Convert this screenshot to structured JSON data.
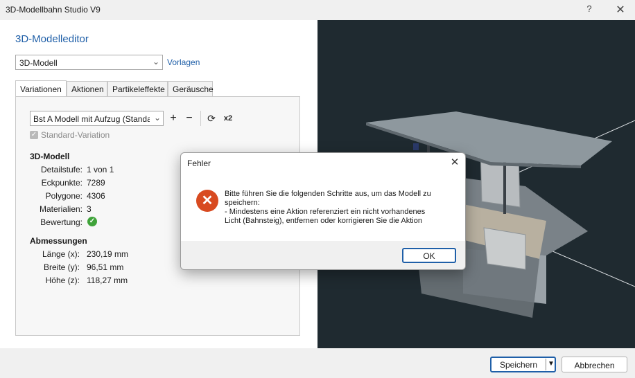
{
  "window": {
    "title": "3D-Modellbahn Studio V9",
    "help": "?",
    "close": "✕"
  },
  "editor": {
    "heading": "3D-Modelleditor",
    "model_select": "3D-Modell",
    "templates_link": "Vorlagen",
    "tabs": [
      {
        "label": "Variationen"
      },
      {
        "label": "Aktionen"
      },
      {
        "label": "Partikeleffekte"
      },
      {
        "label": "Geräusche"
      }
    ],
    "variation_select": "Bst A Modell mit Aufzug (Standard)",
    "toolbar": {
      "add": "+",
      "remove": "−",
      "refresh": "⟳",
      "double": "x2"
    },
    "standard_variation_label": "Standard-Variation",
    "model_section": {
      "title": "3D-Modell",
      "rows": [
        {
          "label": "Detailstufe:",
          "value": "1 von 1"
        },
        {
          "label": "Eckpunkte:",
          "value": "7289"
        },
        {
          "label": "Polygone:",
          "value": "4306"
        },
        {
          "label": "Materialien:",
          "value": "3"
        },
        {
          "label": "Bewertung:",
          "value": ""
        }
      ]
    },
    "dimensions_section": {
      "title": "Abmessungen",
      "rows": [
        {
          "label": "Länge (x):",
          "value": "230,19 mm"
        },
        {
          "label": "Breite (y):",
          "value": "96,51 mm"
        },
        {
          "label": "Höhe (z):",
          "value": "118,27 mm"
        }
      ]
    }
  },
  "buttons": {
    "save": "Speichern",
    "cancel": "Abbrechen"
  },
  "dialog": {
    "title": "Fehler",
    "icon": "✕",
    "message_lines": [
      "Bitte führen Sie die folgenden Schritte aus, um das Modell zu",
      "speichern:",
      "- Mindestens eine Aktion referenziert ein nicht vorhandenes",
      "Licht (Bahnsteig), entfernen oder korrigieren Sie die Aktion"
    ],
    "ok": "OK"
  },
  "colors": {
    "accent": "#1f5fa8",
    "error": "#d84a20",
    "success": "#3fa33a",
    "viewport_bg": "#1f2a30"
  }
}
